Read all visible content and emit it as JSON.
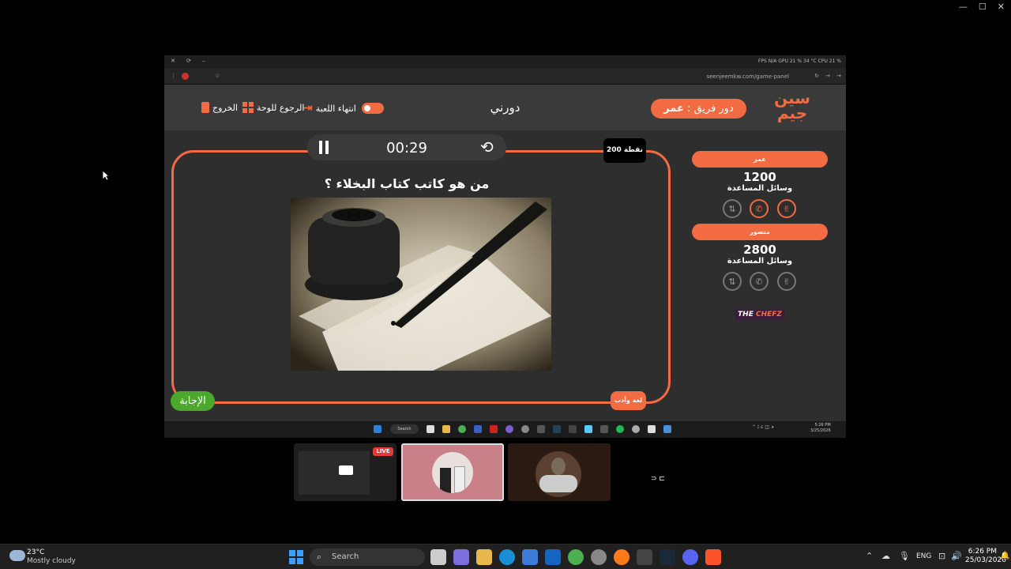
{
  "browser": {
    "url": "seenjeemkw.com/game-panel",
    "stats": "FPS N/A   GPU 21 %  34 °C   CPU 21 %"
  },
  "header": {
    "turn_label": "دور فريق :",
    "turn_team": "عمر",
    "center_title": "دورني",
    "end_game": "انتهاء اللعبة",
    "back_board": "الرجوع للوحة",
    "exit": "الخروج",
    "logo_top": "سين",
    "logo_bottom": "جيم"
  },
  "question": {
    "points": "200 نقطة",
    "timer": "00:29",
    "text": "من هو كاتب كتاب البخلاء ؟",
    "category": "لغة وأدب",
    "answer_button": "الإجابة"
  },
  "teams": [
    {
      "name": "عمر",
      "score": "1200",
      "aids_label": "وسائل المساعدة",
      "aids_active": true
    },
    {
      "name": "منصور",
      "score": "2800",
      "aids_label": "وسائل المساعدة",
      "aids_active": false
    }
  ],
  "sponsor": {
    "text_a": "THE ",
    "text_b": "CHEFZ"
  },
  "inner_taskbar": {
    "search": "Search",
    "time": "5:26 PM",
    "date": "3/25/2026"
  },
  "thumbnails": {
    "live": "LIVE"
  },
  "taskbar": {
    "weather_temp": "23°C",
    "weather_desc": "Mostly cloudy",
    "search": "Search",
    "lang": "ENG",
    "time": "6:26 PM",
    "date": "25/03/2026"
  },
  "colors": {
    "accent": "#f26b43",
    "answer_green": "#4ca82d",
    "body_bg": "#2e2e2e"
  }
}
